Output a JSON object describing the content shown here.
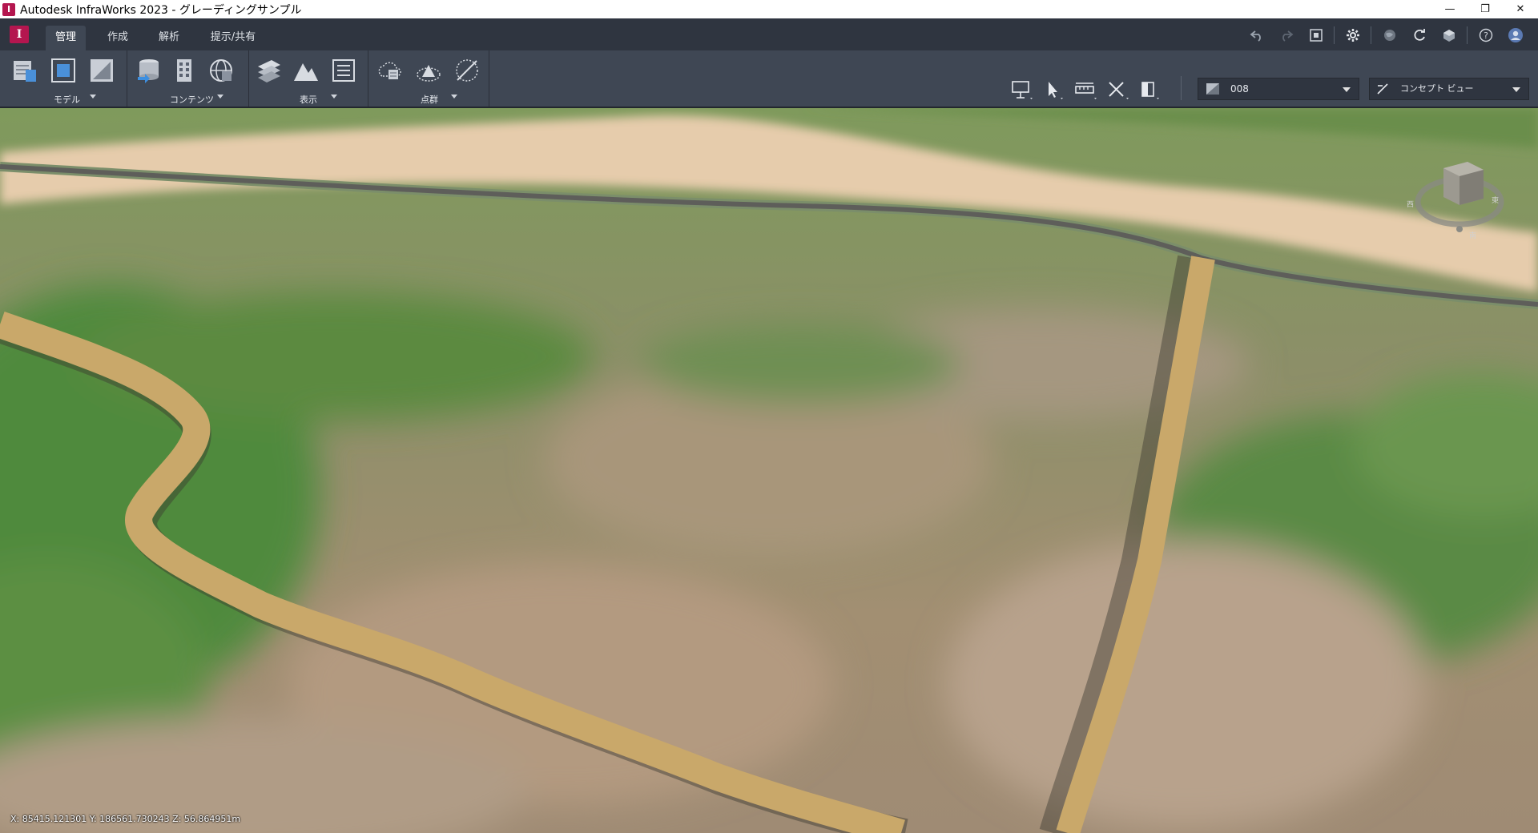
{
  "window": {
    "app_badge": "I",
    "title": "Autodesk InfraWorks 2023 - グレーディングサンプル",
    "controls": {
      "minimize": "—",
      "restore": "❐",
      "close": "✕"
    }
  },
  "tabs": [
    {
      "label": "管理",
      "active": true
    },
    {
      "label": "作成",
      "active": false
    },
    {
      "label": "解析",
      "active": false
    },
    {
      "label": "提示/共有",
      "active": false
    }
  ],
  "logo_letter": "I",
  "quick_access_icons": [
    "undo-icon",
    "redo-icon",
    "fit-view-icon",
    "settings-icon",
    "globe-icon",
    "sync-icon",
    "cloud-model-icon",
    "help-icon",
    "user-avatar-icon"
  ],
  "ribbon": {
    "panels": [
      {
        "label": "モデル",
        "icons": [
          "model-properties-icon",
          "model-view-icon",
          "surface-layers-icon"
        ]
      },
      {
        "label": "コンテンツ",
        "icons": [
          "data-sources-icon",
          "building-content-icon",
          "model-explorer-icon"
        ]
      },
      {
        "label": "表示",
        "icons": [
          "style-palette-icon",
          "terrain-theme-icon",
          "view-list-icon"
        ]
      },
      {
        "label": "点群",
        "icons": [
          "point-cloud-icon",
          "terrain-point-icon",
          "point-modify-icon"
        ]
      }
    ],
    "view_tools": [
      "presentation-icon",
      "select-icon",
      "measure-icon",
      "clip-icon",
      "split-view-icon"
    ],
    "scenario_select": "008",
    "view_select": "コンセプト ビュー"
  },
  "status": {
    "coordinates": "X: 85415.121301 Y: 186561.730243 Z: 56.864951m"
  },
  "colors": {
    "accent": "#b4164f",
    "ribbon": "#3f4754",
    "tabbar": "#2f3540",
    "grading_road": "#c9a86a"
  }
}
